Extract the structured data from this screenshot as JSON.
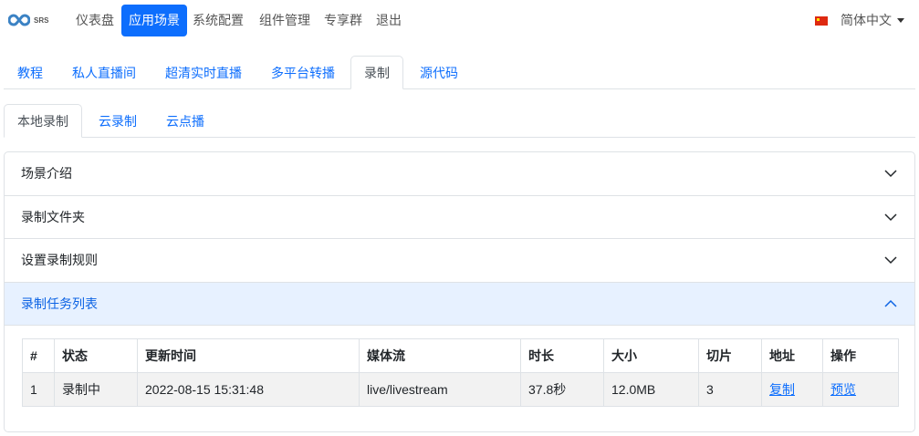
{
  "nav": {
    "logo_text": "SRS",
    "items": [
      "仪表盘",
      "应用场景",
      "系统配置",
      "组件管理",
      "专享群",
      "退出"
    ],
    "active": 1,
    "language": "简体中文"
  },
  "tabs": {
    "items": [
      "教程",
      "私人直播间",
      "超清实时直播",
      "多平台转播",
      "录制",
      "源代码"
    ],
    "active": 4
  },
  "subtabs": {
    "items": [
      "本地录制",
      "云录制",
      "云点播"
    ],
    "active": 0
  },
  "accordion": {
    "items": [
      "场景介绍",
      "录制文件夹",
      "设置录制规则",
      "录制任务列表"
    ],
    "open": 3
  },
  "table": {
    "headers": [
      "#",
      "状态",
      "更新时间",
      "媒体流",
      "时长",
      "大小",
      "切片",
      "地址",
      "操作"
    ],
    "rows": [
      {
        "index": "1",
        "status": "录制中",
        "updated": "2022-08-15 15:31:48",
        "stream": "live/livestream",
        "duration": "37.8秒",
        "size": "12.0MB",
        "segments": "3",
        "address_link": "复制",
        "action_link": "预览"
      }
    ]
  },
  "colors": {
    "accent": "#0d6efd",
    "open_bg": "#e7f1ff"
  }
}
